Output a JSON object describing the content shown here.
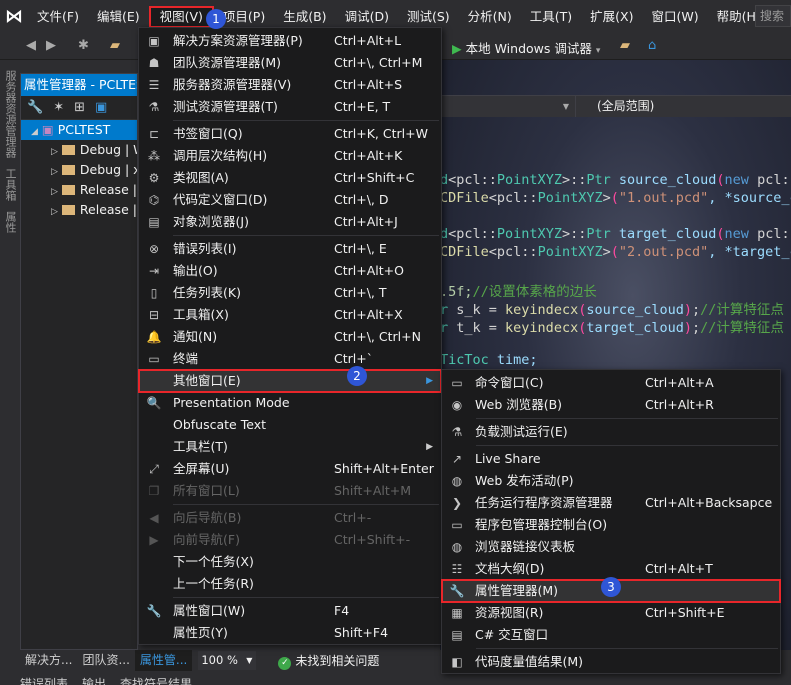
{
  "menubar": {
    "items": [
      "文件(F)",
      "编辑(E)",
      "视图(V)",
      "项目(P)",
      "生成(B)",
      "调试(D)",
      "测试(S)",
      "分析(N)",
      "工具(T)",
      "扩展(X)",
      "窗口(W)",
      "帮助(H)"
    ],
    "active_index": 2,
    "search_placeholder": "搜索"
  },
  "toolbar": {
    "run_label": "本地 Windows 调试器"
  },
  "left_tabs": [
    "服务器资源管理器",
    "工具箱",
    "属性"
  ],
  "property_manager": {
    "title": "属性管理器 - PCLTEST",
    "root": "PCLTEST",
    "configs": [
      "Debug | W",
      "Debug | x",
      "Release |",
      "Release |"
    ]
  },
  "editor": {
    "scope_dropdown": "(全局范围)",
    "code_lines": [
      [
        [
          "d",
          "#4ec9b0"
        ],
        [
          "<pcl::",
          "#d4d4d4"
        ],
        [
          "PointXYZ",
          "#4ec9b0"
        ],
        [
          ">::",
          "#d4d4d4"
        ],
        [
          "Ptr",
          "#4ec9b0"
        ],
        [
          " source_cloud",
          "#9cdcfe"
        ],
        [
          "(",
          "#ff4aa0"
        ],
        [
          "new",
          "#569cd6"
        ],
        [
          " pcl::",
          "#d4d4d4"
        ]
      ],
      [
        [
          "CDFile",
          "#dcdcaa"
        ],
        [
          "<pcl::",
          "#d4d4d4"
        ],
        [
          "PointXYZ",
          "#4ec9b0"
        ],
        [
          ">",
          "#d4d4d4"
        ],
        [
          "(",
          "#ff4aa0"
        ],
        [
          "\"1.out.pcd\"",
          "#ce9178"
        ],
        [
          ", *source_c",
          "#9cdcfe"
        ]
      ],
      [],
      [
        [
          "d",
          "#4ec9b0"
        ],
        [
          "<pcl::",
          "#d4d4d4"
        ],
        [
          "PointXYZ",
          "#4ec9b0"
        ],
        [
          ">::",
          "#d4d4d4"
        ],
        [
          "Ptr",
          "#4ec9b0"
        ],
        [
          " target_cloud",
          "#9cdcfe"
        ],
        [
          "(",
          "#ff4aa0"
        ],
        [
          "new",
          "#569cd6"
        ],
        [
          " pcl::",
          "#d4d4d4"
        ]
      ],
      [
        [
          "CDFile",
          "#dcdcaa"
        ],
        [
          "<pcl::",
          "#d4d4d4"
        ],
        [
          "PointXYZ",
          "#4ec9b0"
        ],
        [
          ">",
          "#d4d4d4"
        ],
        [
          "(",
          "#ff4aa0"
        ],
        [
          "\"2.out.pcd\"",
          "#ce9178"
        ],
        [
          ", *target_c",
          "#9cdcfe"
        ]
      ],
      [],
      [
        [
          ".5f;",
          "#b5cea8"
        ],
        [
          "//设置体素格的边长",
          "#57a64a"
        ]
      ],
      [
        [
          "r",
          "#4ec9b0"
        ],
        [
          " s_k = ",
          "#d4d4d4"
        ],
        [
          "keyindecx",
          "#dcdcaa"
        ],
        [
          "(",
          "#ff4aa0"
        ],
        [
          "source_cloud",
          "#9cdcfe"
        ],
        [
          ")",
          "#ff4aa0"
        ],
        [
          ";",
          "#d4d4d4"
        ],
        [
          "//计算特征点",
          "#57a64a"
        ]
      ],
      [
        [
          "r",
          "#4ec9b0"
        ],
        [
          " t_k = ",
          "#d4d4d4"
        ],
        [
          "keyindecx",
          "#dcdcaa"
        ],
        [
          "(",
          "#ff4aa0"
        ],
        [
          "target_cloud",
          "#9cdcfe"
        ],
        [
          ")",
          "#ff4aa0"
        ],
        [
          ";",
          "#d4d4d4"
        ],
        [
          "//计算特征点",
          "#57a64a"
        ]
      ],
      [],
      [
        [
          "TicToc",
          "#4ec9b0"
        ],
        [
          " time;",
          "#9cdcfe"
        ]
      ]
    ]
  },
  "view_menu": {
    "items": [
      {
        "icon": "solution-explorer-icon",
        "glyph": "▣",
        "label": "解决方案资源管理器(P)",
        "shortcut": "Ctrl+Alt+L"
      },
      {
        "icon": "team-explorer-icon",
        "glyph": "☗",
        "label": "团队资源管理器(M)",
        "shortcut": "Ctrl+\\, Ctrl+M"
      },
      {
        "icon": "server-explorer-icon",
        "glyph": "☰",
        "label": "服务器资源管理器(V)",
        "shortcut": "Ctrl+Alt+S"
      },
      {
        "icon": "test-explorer-icon",
        "glyph": "⚗",
        "label": "测试资源管理器(T)",
        "shortcut": "Ctrl+E, T"
      },
      {
        "sep": true
      },
      {
        "icon": "bookmark-icon",
        "glyph": "⊏",
        "label": "书签窗口(Q)",
        "shortcut": "Ctrl+K, Ctrl+W"
      },
      {
        "icon": "call-hierarchy-icon",
        "glyph": "⁂",
        "label": "调用层次结构(H)",
        "shortcut": "Ctrl+Alt+K"
      },
      {
        "icon": "class-view-icon",
        "glyph": "⚙",
        "label": "类视图(A)",
        "shortcut": "Ctrl+Shift+C"
      },
      {
        "icon": "code-definition-icon",
        "glyph": "⌬",
        "label": "代码定义窗口(D)",
        "shortcut": "Ctrl+\\, D"
      },
      {
        "icon": "object-browser-icon",
        "glyph": "▤",
        "label": "对象浏览器(J)",
        "shortcut": "Ctrl+Alt+J"
      },
      {
        "sep": true
      },
      {
        "icon": "error-list-icon",
        "glyph": "⊗",
        "label": "错误列表(I)",
        "shortcut": "Ctrl+\\, E"
      },
      {
        "icon": "output-icon",
        "glyph": "⇥",
        "label": "输出(O)",
        "shortcut": "Ctrl+Alt+O"
      },
      {
        "icon": "task-list-icon",
        "glyph": "▯",
        "label": "任务列表(K)",
        "shortcut": "Ctrl+\\, T"
      },
      {
        "icon": "toolbox-icon",
        "glyph": "⊟",
        "label": "工具箱(X)",
        "shortcut": "Ctrl+Alt+X"
      },
      {
        "icon": "notification-bell-icon",
        "glyph": "🔔",
        "label": "通知(N)",
        "shortcut": "Ctrl+\\, Ctrl+N"
      },
      {
        "icon": "terminal-icon",
        "glyph": "▭",
        "label": "终端",
        "shortcut": "Ctrl+`"
      },
      {
        "label": "其他窗口(E)",
        "submenu": true,
        "highlighted": true
      },
      {
        "icon": "presentation-mode-icon",
        "glyph": "🔍",
        "label": "Presentation Mode"
      },
      {
        "label": "Obfuscate Text"
      },
      {
        "label": "工具栏(T)",
        "submenu": true
      },
      {
        "icon": "full-screen-icon",
        "glyph": "⤢",
        "label": "全屏幕(U)",
        "shortcut": "Shift+Alt+Enter"
      },
      {
        "icon": "all-windows-icon",
        "glyph": "❐",
        "label": "所有窗口(L)",
        "shortcut": "Shift+Alt+M",
        "disabled": true
      },
      {
        "sep": true
      },
      {
        "icon": "navigate-back-icon",
        "glyph": "◀",
        "label": "向后导航(B)",
        "shortcut": "Ctrl+-",
        "disabled": true
      },
      {
        "icon": "navigate-forward-icon",
        "glyph": "▶",
        "label": "向前导航(F)",
        "shortcut": "Ctrl+Shift+-",
        "disabled": true
      },
      {
        "label": "下一个任务(X)"
      },
      {
        "label": "上一个任务(R)"
      },
      {
        "sep": true
      },
      {
        "icon": "wrench-icon",
        "glyph": "🔧",
        "label": "属性窗口(W)",
        "shortcut": "F4"
      },
      {
        "label": "属性页(Y)",
        "shortcut": "Shift+F4"
      }
    ]
  },
  "other_windows_menu": {
    "items": [
      {
        "icon": "command-window-icon",
        "glyph": "▭",
        "label": "命令窗口(C)",
        "shortcut": "Ctrl+Alt+A"
      },
      {
        "icon": "web-browser-icon",
        "glyph": "◉",
        "label": "Web 浏览器(B)",
        "shortcut": "Ctrl+Alt+R"
      },
      {
        "sep": true
      },
      {
        "icon": "load-test-icon",
        "glyph": "⚗",
        "label": "负载测试运行(E)"
      },
      {
        "sep": true
      },
      {
        "icon": "live-share-icon",
        "glyph": "↗",
        "label": "Live Share"
      },
      {
        "icon": "web-publish-icon",
        "glyph": "◍",
        "label": "Web 发布活动(P)"
      },
      {
        "icon": "chevron-right-icon",
        "glyph": "❯",
        "label": "任务运行程序资源管理器",
        "shortcut": "Ctrl+Alt+Backsapce"
      },
      {
        "icon": "console-icon",
        "glyph": "▭",
        "label": "程序包管理器控制台(O)"
      },
      {
        "icon": "browser-link-icon",
        "glyph": "◍",
        "label": "浏览器链接仪表板"
      },
      {
        "icon": "document-outline-icon",
        "glyph": "☷",
        "label": "文档大纲(D)",
        "shortcut": "Ctrl+Alt+T"
      },
      {
        "icon": "wrench-icon",
        "glyph": "🔧",
        "label": "属性管理器(M)",
        "highlighted": true
      },
      {
        "icon": "resource-view-icon",
        "glyph": "▦",
        "label": "资源视图(R)",
        "shortcut": "Ctrl+Shift+E"
      },
      {
        "icon": "csharp-interactive-icon",
        "glyph": "▤",
        "label": "C# 交互窗口"
      },
      {
        "sep": true
      },
      {
        "icon": "code-metrics-icon",
        "glyph": "◧",
        "label": "代码度量值结果(M)"
      }
    ]
  },
  "badges": [
    "1",
    "2",
    "3"
  ],
  "bottom_tabs": [
    "解决方...",
    "团队资...",
    "属性管..."
  ],
  "active_bottom_tab": 2,
  "zoom": "100 %",
  "status": "未找到相关问题",
  "output_tabs": [
    "错误列表",
    "输出",
    "查找符号结果"
  ],
  "colors": {
    "accent": "#007acc",
    "highlight_box": "#e8262a",
    "badge": "#2f56d6"
  }
}
